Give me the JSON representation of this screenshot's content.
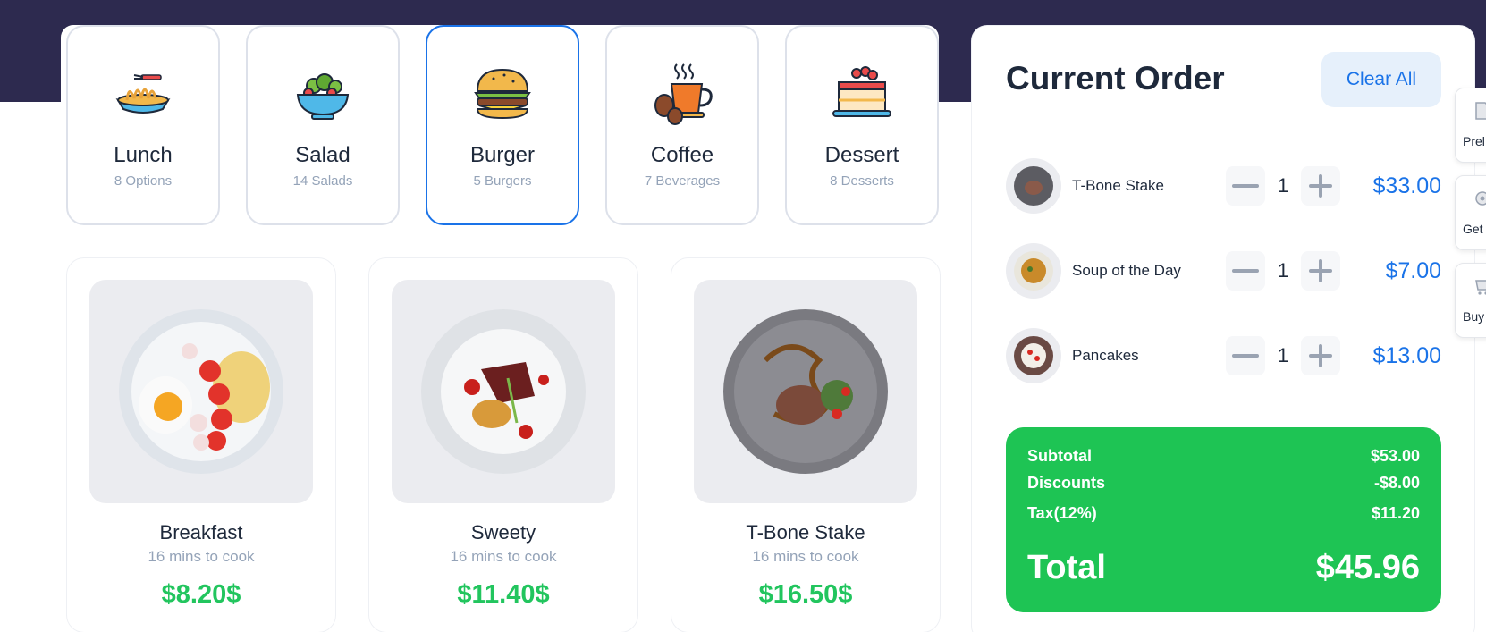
{
  "categories": [
    {
      "name": "Lunch",
      "sub": "8 Options",
      "icon": "noodles-icon",
      "active": false
    },
    {
      "name": "Salad",
      "sub": "14 Salads",
      "icon": "salad-bowl-icon",
      "active": false
    },
    {
      "name": "Burger",
      "sub": "5 Burgers",
      "icon": "burger-icon",
      "active": true
    },
    {
      "name": "Coffee",
      "sub": "7 Beverages",
      "icon": "coffee-cup-icon",
      "active": false
    },
    {
      "name": "Dessert",
      "sub": "8 Desserts",
      "icon": "cake-icon",
      "active": false
    }
  ],
  "products": [
    {
      "name": "Breakfast",
      "time": "16 mins to cook",
      "price": "$8.20$"
    },
    {
      "name": "Sweety",
      "time": "16 mins to cook",
      "price": "$11.40$"
    },
    {
      "name": "T-Bone Stake",
      "time": "16 mins to cook",
      "price": "$16.50$"
    }
  ],
  "order": {
    "title": "Current Order",
    "clear_label": "Clear All",
    "items": [
      {
        "name": "T-Bone Stake",
        "qty": "1",
        "price": "$33.00"
      },
      {
        "name": "Soup of the Day",
        "qty": "1",
        "price": "$7.00"
      },
      {
        "name": "Pancakes",
        "qty": "1",
        "price": "$13.00"
      }
    ],
    "summary": {
      "subtotal_label": "Subtotal",
      "subtotal": "$53.00",
      "discounts_label": "Discounts",
      "discounts": "-$8.00",
      "tax_label": "Tax(12%)",
      "tax": "$11.20",
      "total_label": "Total",
      "total": "$45.96"
    }
  },
  "side_tabs": [
    {
      "label": "Prel"
    },
    {
      "label": "Get"
    },
    {
      "label": "Buy"
    }
  ],
  "colors": {
    "header_band": "#2d2a4f",
    "accent_blue": "#1a73e8",
    "price_green": "#22c55e",
    "summary_green": "#1ec454"
  }
}
